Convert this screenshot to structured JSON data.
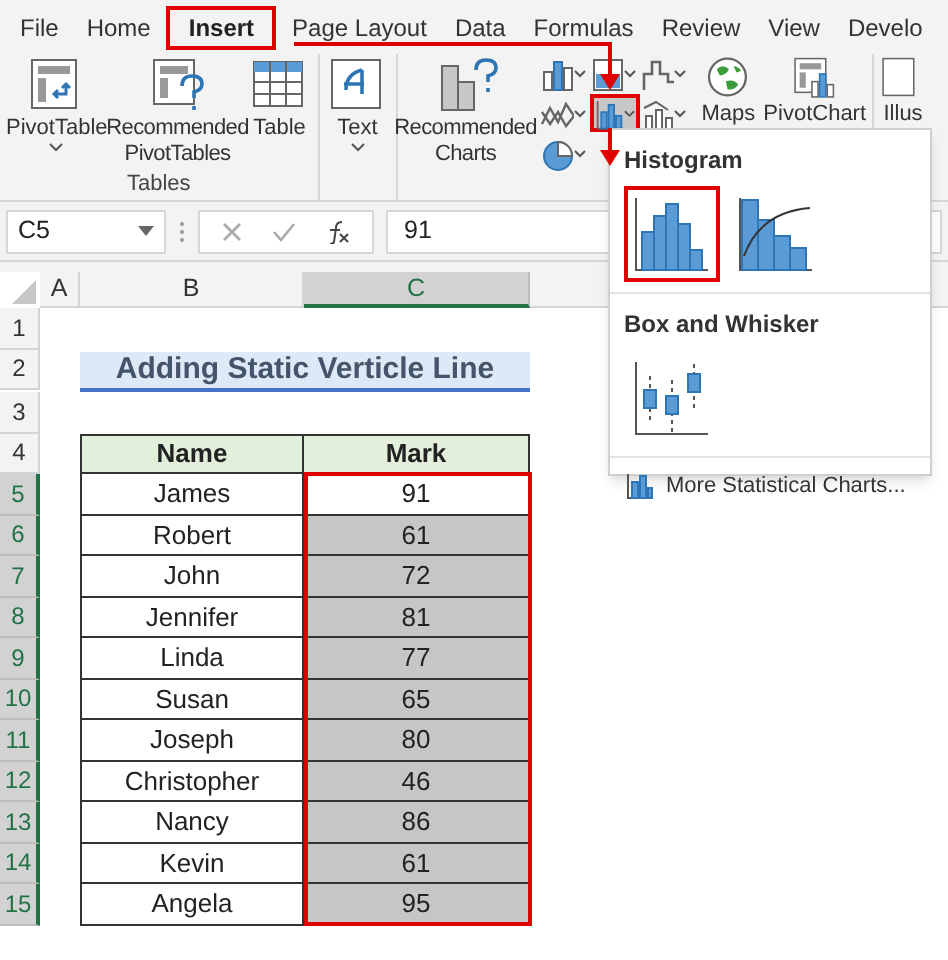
{
  "tabs": [
    {
      "label": "File",
      "selected": false
    },
    {
      "label": "Home",
      "selected": false
    },
    {
      "label": "Insert",
      "selected": true
    },
    {
      "label": "Page Layout",
      "selected": false
    },
    {
      "label": "Data",
      "selected": false
    },
    {
      "label": "Formulas",
      "selected": false
    },
    {
      "label": "Review",
      "selected": false
    },
    {
      "label": "View",
      "selected": false
    },
    {
      "label": "Develo",
      "selected": false
    }
  ],
  "ribbon": {
    "groups": [
      {
        "label": "Tables",
        "buttons": [
          {
            "kind": "pivottable",
            "label": "PivotTable",
            "dropdown": true
          },
          {
            "kind": "recommended_pivottables",
            "label": "Recommended PivotTables"
          },
          {
            "kind": "table",
            "label": "Table"
          }
        ]
      },
      {
        "buttons": [
          {
            "kind": "text",
            "label": "Text",
            "dropdown": true
          }
        ]
      },
      {
        "buttons": [
          {
            "kind": "recommended_charts",
            "label": "Recommended Charts"
          },
          {
            "kind": "chart_grid",
            "items": [
              {
                "kind": "column",
                "selected": false
              },
              {
                "kind": "hierarchy",
                "selected": false
              },
              {
                "kind": "waterfall",
                "selected": false
              },
              {
                "kind": "line",
                "selected": false
              },
              {
                "kind": "statistic",
                "selected": true
              },
              {
                "kind": "combo",
                "selected": false
              },
              {
                "kind": "pie",
                "selected": false
              }
            ]
          },
          {
            "kind": "maps",
            "label": "Maps"
          },
          {
            "kind": "pivotchart",
            "label": "PivotChart"
          }
        ]
      },
      {
        "buttons": [
          {
            "kind": "illustrations",
            "label": "Illus"
          }
        ]
      }
    ]
  },
  "formula_bar": {
    "name_box": "C5",
    "value": "91"
  },
  "dropdown": {
    "sections": [
      {
        "title": "Histogram",
        "items": [
          {
            "kind": "histogram",
            "selected": true
          },
          {
            "kind": "pareto",
            "selected": false
          }
        ]
      },
      {
        "title": "Box and Whisker",
        "items": [
          {
            "kind": "box_whisker",
            "selected": false
          }
        ]
      }
    ],
    "footer": "More Statistical Charts..."
  },
  "sheet": {
    "columns": [
      {
        "label": "A",
        "selected": false
      },
      {
        "label": "B",
        "selected": false
      },
      {
        "label": "C",
        "selected": true
      }
    ],
    "rows": [
      {
        "label": "1",
        "selected": false
      },
      {
        "label": "2",
        "selected": false
      },
      {
        "label": "3",
        "selected": false
      },
      {
        "label": "4",
        "selected": false
      },
      {
        "label": "5",
        "selected": true
      },
      {
        "label": "6",
        "selected": true
      },
      {
        "label": "7",
        "selected": true
      },
      {
        "label": "8",
        "selected": true
      },
      {
        "label": "9",
        "selected": true
      },
      {
        "label": "10",
        "selected": true
      },
      {
        "label": "11",
        "selected": true
      },
      {
        "label": "12",
        "selected": true
      },
      {
        "label": "13",
        "selected": true
      },
      {
        "label": "14",
        "selected": true
      },
      {
        "label": "15",
        "selected": true
      }
    ],
    "title": "Adding Static Verticle Line",
    "table": {
      "columns": [
        "Name",
        "Mark"
      ],
      "rows": [
        {
          "name": "James",
          "mark": "91",
          "selected": false
        },
        {
          "name": "Robert",
          "mark": "61",
          "selected": true
        },
        {
          "name": "John",
          "mark": "72",
          "selected": true
        },
        {
          "name": "Jennifer",
          "mark": "81",
          "selected": true
        },
        {
          "name": "Linda",
          "mark": "77",
          "selected": true
        },
        {
          "name": "Susan",
          "mark": "65",
          "selected": true
        },
        {
          "name": "Joseph",
          "mark": "80",
          "selected": true
        },
        {
          "name": "Christopher",
          "mark": "46",
          "selected": true
        },
        {
          "name": "Nancy",
          "mark": "86",
          "selected": true
        },
        {
          "name": "Kevin",
          "mark": "61",
          "selected": true
        },
        {
          "name": "Angela",
          "mark": "95",
          "selected": true
        }
      ]
    }
  }
}
